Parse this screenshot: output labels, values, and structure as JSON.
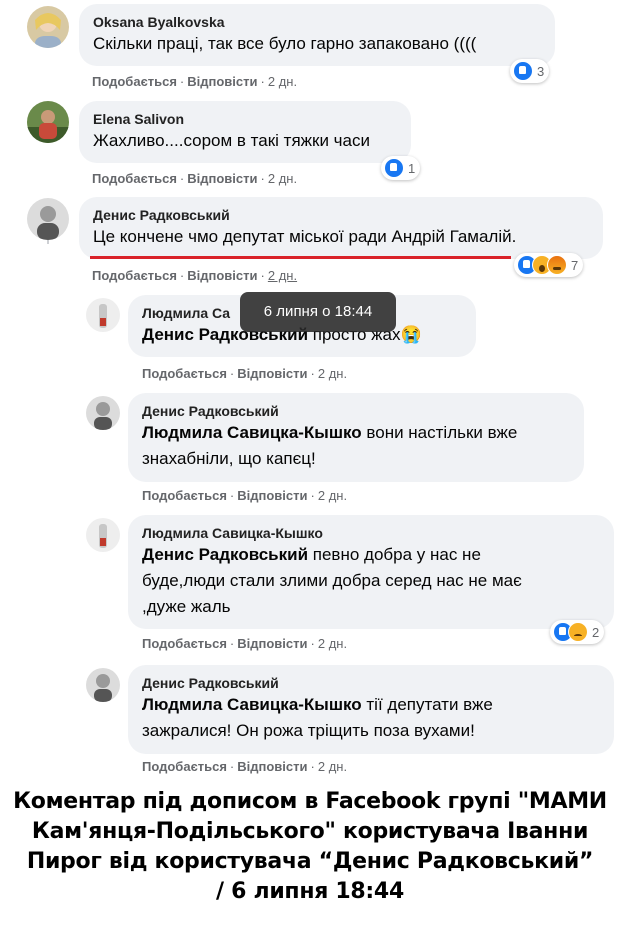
{
  "comments": [
    {
      "author": "Oksana Byalkovska",
      "text": "Скільки праці, так все було гарно запаковано ((((",
      "like": "Подобається",
      "reply": "Відповісти",
      "time": "2 дн.",
      "reaction_count": "3"
    },
    {
      "author": "Elena Salivon",
      "text": "Жахливо....сором в такі тяжки часи",
      "like": "Подобається",
      "reply": "Відповісти",
      "time": "2 дн.",
      "reaction_count": "1"
    },
    {
      "author": "Денис Радковський",
      "text": "Це кончене чмо депутат міської ради Андрій Гамалій.",
      "like": "Подобається",
      "reply": "Відповісти",
      "time": "2 дн.",
      "reaction_count": "7"
    }
  ],
  "replies": [
    {
      "author": "Людмила Са",
      "mention": "Денис Радковський",
      "text": " просто жах😭",
      "like": "Подобається",
      "reply": "Відповісти",
      "time": "2 дн."
    },
    {
      "author": "Денис Радковський",
      "mention": "Людмила Савицка-Кышко",
      "text_line1": " вони настільки вже",
      "text_line2": "знахабніли, що капєц!",
      "like": "Подобається",
      "reply": "Відповісти",
      "time": "2 дн."
    },
    {
      "author": "Людмила Савицка-Кышко",
      "mention": "Денис Радковський",
      "text_line1": " певно добра у нас не",
      "text_line2": "буде,люди стали злими добра серед нас не має",
      "text_line3": ",дуже жаль",
      "like": "Подобається",
      "reply": "Відповісти",
      "time": "2 дн.",
      "reaction_count": "2"
    },
    {
      "author": "Денис Радковський",
      "mention": "Людмила Савицка-Кышко",
      "text_line1": " тії депутати вже",
      "text_line2": "зажралися! Он рожа тріщить поза вухами!",
      "like": "Подобається",
      "reply": "Відповісти",
      "time": "2 дн."
    }
  ],
  "tooltip": "6 липня о 18:44",
  "caption": {
    "line1": "Коментар під дописом в Facebook групі \"МАМИ",
    "line2": "Кам'янця-Подільського\" користувача Іванни",
    "line3": "Пирог від користувача “Денис Радковський”",
    "line4": "/ 6 липня 18:44"
  },
  "colors": {
    "bubble": "#f0f2f5",
    "like_blue": "#1877f2",
    "underline_red": "#d9222a",
    "meta_gray": "#65676b"
  }
}
